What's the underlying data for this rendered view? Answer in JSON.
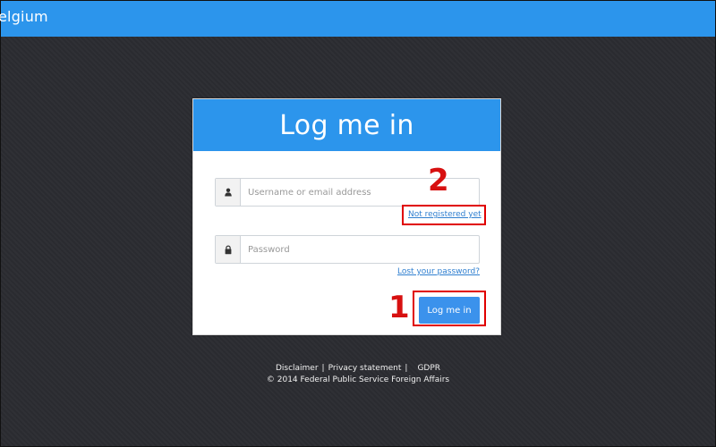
{
  "header": {
    "title": "elgium"
  },
  "login": {
    "title": "Log me in",
    "username_placeholder": "Username or email address",
    "password_placeholder": "Password",
    "not_registered_link": "Not registered yet",
    "lost_password_link": "Lost your password?",
    "submit_button": "Log me in"
  },
  "annotations": {
    "step_1": "1",
    "step_2": "2",
    "highlight_color": "#e00000"
  },
  "footer": {
    "disclaimer": "Disclaimer",
    "separator_1": "|",
    "privacy_statement": "Privacy statement",
    "separator_2": "|",
    "gdpr": "GDPR",
    "copyright": "© 2014 Federal Public Service Foreign Affairs"
  },
  "icons": {
    "username": "user-icon",
    "password": "lock-icon"
  },
  "colors": {
    "primary_blue": "#2c95ec",
    "background": "#2b2c31",
    "link": "#2f7fd0",
    "annotation_red": "#e00000"
  }
}
